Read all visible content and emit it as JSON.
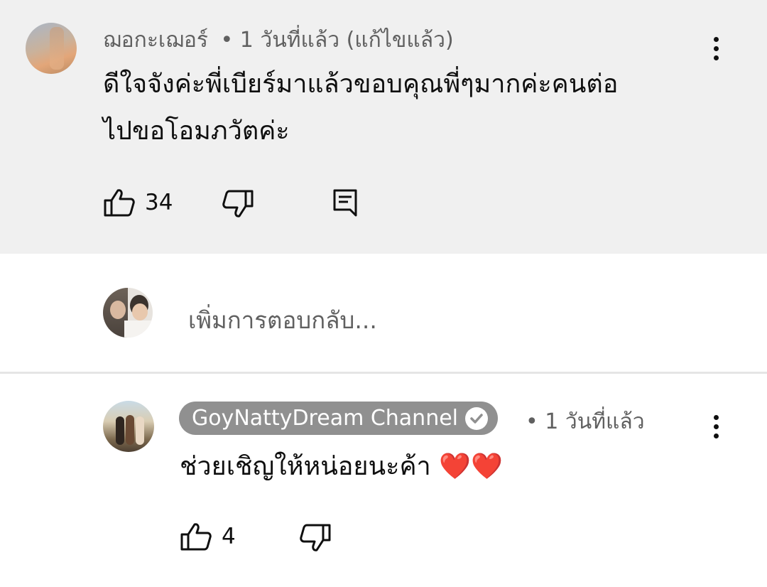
{
  "comment": {
    "author": "ฌอกะเฌอร์",
    "meta": "• 1 วันที่แล้ว (แก้ไขแล้ว)",
    "text_line1": "ดีใจจังค่ะพี่เบียร์มาแล้วขอบคุณพี่ๆมากค่ะคนต่อ",
    "text_line2": "ไปขอโอมภวัตค่ะ",
    "likes": "34",
    "icons": {
      "like": "thumb-up-icon",
      "dislike": "thumb-down-icon",
      "reply": "reply-comment-icon",
      "menu": "more-vert-icon"
    }
  },
  "reply_box": {
    "placeholder": "เพิ่มการตอบกลับ..."
  },
  "reply": {
    "author": "GoyNattyDream Channel",
    "meta": "• 1 วันที่แล้ว",
    "text": "ช่วยเชิญให้หน่อยนะค้า ❤️❤️",
    "likes": "4",
    "icons": {
      "verified": "verified-check-icon",
      "like": "thumb-up-icon",
      "dislike": "thumb-down-icon",
      "menu": "more-vert-icon"
    }
  },
  "colors": {
    "highlight_bg": "#f0f0f0",
    "secondary_text": "#606060",
    "channel_badge": "#909090",
    "heart": "#e0112b"
  }
}
